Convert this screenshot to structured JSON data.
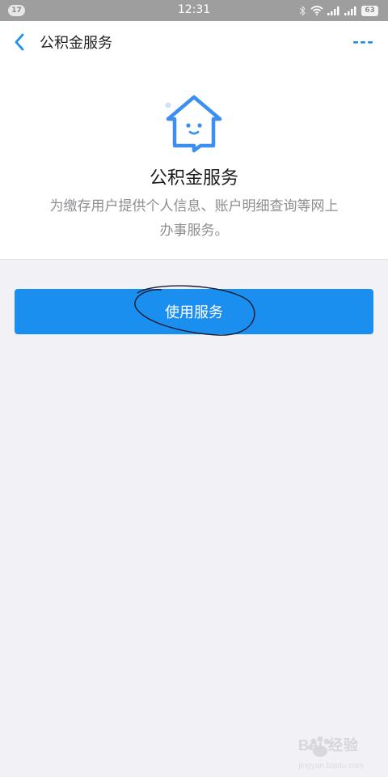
{
  "status_bar": {
    "notification_count": "17",
    "time": "12:31",
    "battery_level": "63",
    "icons": [
      "bluetooth-icon",
      "wifi-icon",
      "signal-icon",
      "signal-icon",
      "battery-icon"
    ]
  },
  "header": {
    "title": "公积金服务",
    "back_icon": "chevron-left-icon",
    "more_icon": "more-dots-icon"
  },
  "intro": {
    "icon": "house-smile-icon",
    "title": "公积金服务",
    "description": "为缴存用户提供个人信息、账户明细查询等网上办事服务。"
  },
  "action": {
    "use_service_label": "使用服务"
  },
  "watermark": {
    "brand": "Bai 经验",
    "url": "jingyan.baidu.com"
  },
  "colors": {
    "accent": "#1b8ff0",
    "status_bar": "#9e9e9e",
    "page_background": "#f1f1f6"
  }
}
